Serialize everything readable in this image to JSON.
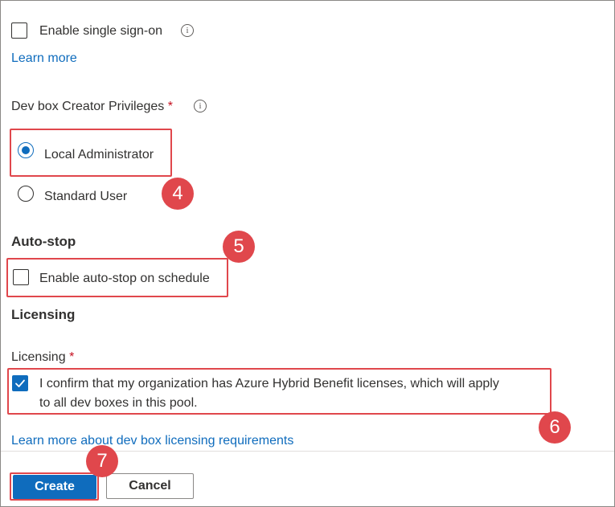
{
  "sso": {
    "checkbox_label": "Enable single sign-on",
    "checked": false,
    "info_icon": "info-icon",
    "learn_more": "Learn more"
  },
  "privileges": {
    "label": "Dev box Creator Privileges",
    "required_mark": "*",
    "info_icon": "info-icon",
    "options": [
      {
        "label": "Local Administrator",
        "selected": true
      },
      {
        "label": "Standard User",
        "selected": false
      }
    ]
  },
  "autostop": {
    "section_title": "Auto-stop",
    "checkbox_label": "Enable auto-stop on schedule",
    "checked": false
  },
  "licensing": {
    "section_title": "Licensing",
    "field_label": "Licensing",
    "required_mark": "*",
    "confirm_line1": "I confirm that my organization has Azure Hybrid Benefit licenses, which will apply",
    "confirm_line2": "to all dev boxes in this pool.",
    "checked": true,
    "learn_more": "Learn more about dev box licensing requirements"
  },
  "footer": {
    "create_label": "Create",
    "cancel_label": "Cancel"
  },
  "annotations": {
    "step4": "4",
    "step5": "5",
    "step6": "6",
    "step7": "7",
    "highlight_color": "#e0474c"
  },
  "colors": {
    "accent": "#0f6cbd",
    "required": "#c50f1f",
    "text": "#323130"
  }
}
